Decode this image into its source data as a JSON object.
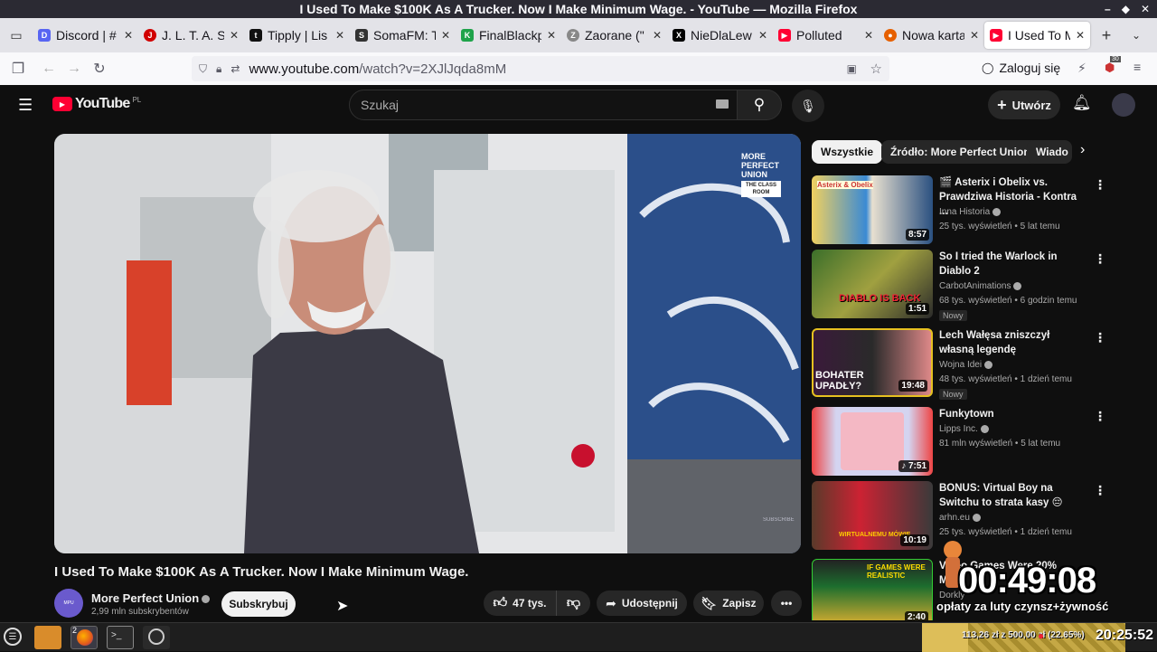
{
  "window": {
    "title": "I Used To Make $100K As A Trucker. Now I Make Minimum Wage. - YouTube — Mozilla Firefox"
  },
  "tabs": [
    {
      "label": "Discord | #",
      "color": "#5865f2",
      "glyph": "D"
    },
    {
      "label": "J. L. T. A. S S",
      "color": "#d10000",
      "glyph": "J"
    },
    {
      "label": "Tipply | Lis",
      "color": "#111111",
      "glyph": "tip"
    },
    {
      "label": "SomaFM: T",
      "color": "#333333",
      "glyph": "S"
    },
    {
      "label": "FinalBlackp",
      "color": "#1fa34a",
      "glyph": "K"
    },
    {
      "label": "Zaorane (\"",
      "color": "#888888",
      "glyph": "Z"
    },
    {
      "label": "NieDlaLew",
      "color": "#000000",
      "glyph": "X"
    },
    {
      "label": "Polluted",
      "color": "#ff0033",
      "glyph": "▶"
    },
    {
      "label": "Nowa karta",
      "color": "#e66000",
      "glyph": "●"
    },
    {
      "label": "I Used To M",
      "color": "#ff0033",
      "glyph": "▶"
    }
  ],
  "address": {
    "host": "www.youtube.com",
    "path": "/watch?v=2XJlJqda8mM"
  },
  "nav": {
    "login": "Zaloguj się",
    "badge": "30"
  },
  "youtube": {
    "logo": "YouTube",
    "region": "PL",
    "search_placeholder": "Szukaj",
    "create_label": "Utwórz",
    "video": {
      "title": "I Used To Make $100K As A Trucker. Now I Make Minimum Wage.",
      "channel": "More Perfect Union",
      "subscribers": "2,99 mln subskrybentów",
      "subscribe": "Subskrybuj",
      "likes": "47 tys.",
      "share": "Udostępnij",
      "save": "Zapisz",
      "overlay_logo": [
        "MORE",
        "PERFECT",
        "UNION"
      ],
      "overlay_sub": [
        "THE CLASS",
        "ROOM"
      ],
      "watermark": "SUBSCRIBE"
    },
    "chips": [
      "Wszystkie",
      "Źródło: More Perfect Union",
      "Wiado"
    ],
    "recommendations": [
      {
        "title": "🎬 Asterix i Obelix vs. Prawdziwa Historia - Kontra ...",
        "channel": "Inna Historia",
        "meta": "25 tys. wyświetleń • 5 lat temu",
        "duration": "8:57",
        "badge": "",
        "thumb_text": "Asterix & Obelix"
      },
      {
        "title": "So I tried the Warlock in Diablo 2",
        "channel": "CarbotAnimations",
        "meta": "68 tys. wyświetleń • 6 godzin temu",
        "duration": "1:51",
        "badge": "Nowy",
        "thumb_text": "DIABLO IS BACK"
      },
      {
        "title": "Lech Wałęsa zniszczył własną legendę",
        "channel": "Wojna Idei",
        "meta": "48 tys. wyświetleń • 1 dzień temu",
        "duration": "19:48",
        "badge": "Nowy",
        "thumb_text": "BOHATER UPADŁY?"
      },
      {
        "title": "Funkytown",
        "channel": "Lipps Inc.",
        "meta": "81 mln wyświetleń • 5 lat temu",
        "duration": "7:51",
        "badge": "",
        "thumb_text": ""
      },
      {
        "title": "BONUS: Virtual Boy na Switchu to strata kasy 😔",
        "channel": "arhn.eu",
        "meta": "25 tys. wyświetleń • 1 dzień temu",
        "duration": "10:19",
        "badge": "",
        "thumb_text": "WIRTUALNEMU MÓWIĘ"
      },
      {
        "title": "Video Games Were 20% More",
        "channel": "Dorkly",
        "meta": "",
        "duration": "2:40",
        "badge": "",
        "thumb_text": "IF GAMES WERE REALISTIC"
      }
    ]
  },
  "overlay": {
    "timer": "00:49:08",
    "line": "opłaty za luty czynsz+żywność",
    "progress_text": "113,26 zł z 500,00 zł (22.65%)",
    "progress": 0.2265
  },
  "taskbar": {
    "clock": "20:25:52",
    "firefox_count": "2"
  },
  "colors": {
    "accent": "#ff0033",
    "bg": "#0f0f0f",
    "chip_active": "#f1f1f1"
  }
}
